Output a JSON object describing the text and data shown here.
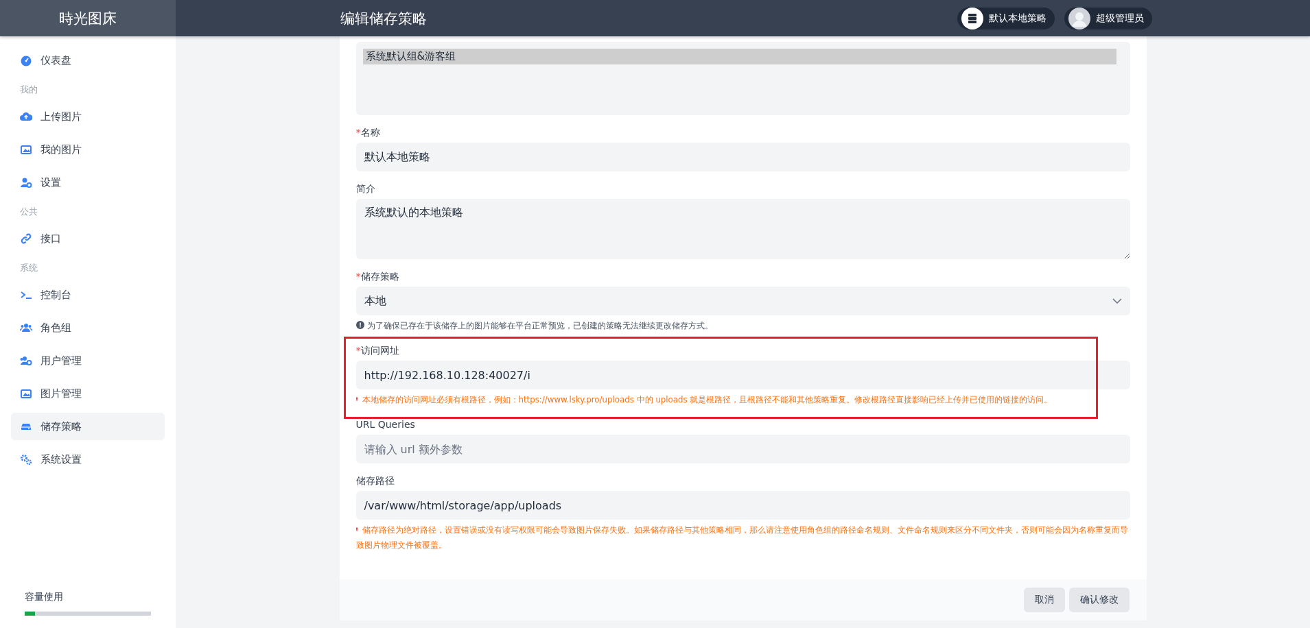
{
  "logo": "時光图床",
  "header": {
    "title": "编辑储存策略",
    "chips": [
      {
        "kind": "policy",
        "label": "默认本地策略"
      },
      {
        "kind": "user",
        "label": "超级管理员"
      }
    ]
  },
  "sidebar": {
    "items": [
      {
        "kind": "link",
        "label": "仪表盘",
        "selected": false
      },
      {
        "kind": "section",
        "label": "我的"
      },
      {
        "kind": "link",
        "label": "上传图片",
        "selected": false
      },
      {
        "kind": "link",
        "label": "我的图片",
        "selected": false
      },
      {
        "kind": "link",
        "label": "设置",
        "selected": false
      },
      {
        "kind": "section",
        "label": "公共"
      },
      {
        "kind": "link",
        "label": "接口",
        "selected": false
      },
      {
        "kind": "section",
        "label": "系统"
      },
      {
        "kind": "link",
        "label": "控制台",
        "selected": false
      },
      {
        "kind": "link",
        "label": "角色组",
        "selected": false
      },
      {
        "kind": "link",
        "label": "用户管理",
        "selected": false
      },
      {
        "kind": "link",
        "label": "图片管理",
        "selected": false
      },
      {
        "kind": "link",
        "label": "储存策略",
        "selected": true
      },
      {
        "kind": "link",
        "label": "系统设置",
        "selected": false
      }
    ],
    "storage": {
      "label": "容量使用",
      "level": 0.08
    }
  },
  "form": {
    "groups": [
      {
        "label": "系统默认组&游客组",
        "selected": true
      }
    ],
    "fields": [
      {
        "kind": "input",
        "label": "名称",
        "required_mark": "*",
        "value": "默认本地策略",
        "highlighted": false
      },
      {
        "kind": "textarea",
        "label": "简介",
        "value": "系统默认的本地策略",
        "highlighted": false
      },
      {
        "kind": "select",
        "label": "储存策略",
        "required_mark": "*",
        "value": "本地",
        "highlighted": false,
        "hint": {
          "kind": "info",
          "text": "为了确保已存在于该储存上的图片能够在平台正常预览，已创建的策略无法继续更改储存方式。"
        }
      },
      {
        "kind": "input",
        "label": "访问网址",
        "required_mark": "*",
        "value": "http://192.168.10.128:40027/i",
        "highlighted": true,
        "hint": {
          "kind": "warning",
          "text": "本地储存的访问网址必须有根路径，例如：https://www.lsky.pro/uploads 中的 uploads 就是根路径，且根路径不能和其他策略重复。修改根路径直接影响已经上传并已使用的链接的访问。"
        }
      },
      {
        "kind": "input",
        "label": "URL Queries",
        "placeholder": "请输入 url 额外参数",
        "highlighted": false
      },
      {
        "kind": "input",
        "label": "储存路径",
        "value": "/var/www/html/storage/app/uploads",
        "highlighted": false,
        "hint": {
          "kind": "warning",
          "text": "储存路径为绝对路径，设置错误或没有读写权限可能会导致图片保存失败。如果储存路径与其他策略相同，那么请注意使用角色组的路径命名规则、文件命名规则来区分不同文件夹，否则可能会因为名称重复而导致图片物理文件被覆盖。"
        }
      }
    ],
    "buttons": [
      "取消",
      "确认修改"
    ]
  }
}
